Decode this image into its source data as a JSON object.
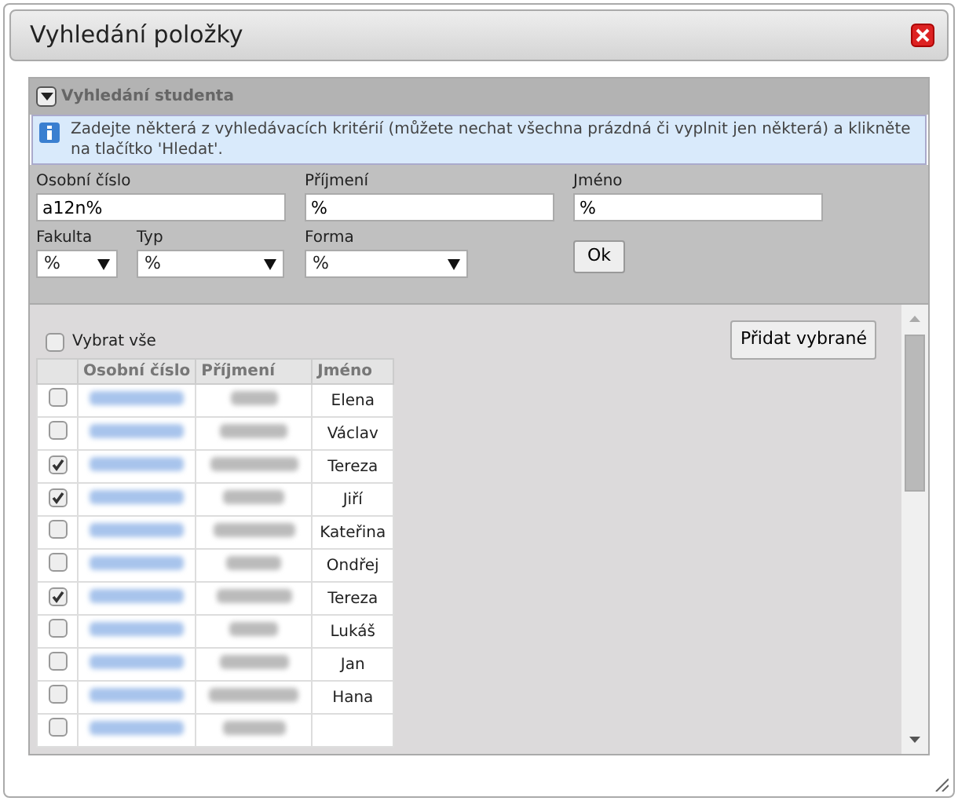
{
  "window": {
    "title": "Vyhledání položky"
  },
  "section": {
    "title": "Vyhledání studenta",
    "expanded": true
  },
  "info": "Zadejte některá z vyhledávacích kritérií (můžete nechat všechna prázdná či vyplnit jen některá) a klikněte na tlačítko 'Hledat'.",
  "fields": [
    {
      "label": "Osobní číslo",
      "value": "a12n%"
    },
    {
      "label": "Příjmení",
      "value": "%"
    },
    {
      "label": "Jméno",
      "value": "%"
    }
  ],
  "selects": [
    {
      "label": "Fakulta",
      "value": "%"
    },
    {
      "label": "Typ",
      "value": "%"
    },
    {
      "label": "Forma",
      "value": "%"
    }
  ],
  "ok_button": "Ok",
  "select_all": {
    "label": "Vybrat vše",
    "checked": false
  },
  "add_button": "Přidat vybrané",
  "table": {
    "columns": [
      "Osobní číslo",
      "Příjmení",
      "Jméno"
    ],
    "rows": [
      {
        "checked": false,
        "name": "Elena"
      },
      {
        "checked": false,
        "name": "Václav"
      },
      {
        "checked": true,
        "name": "Tereza"
      },
      {
        "checked": true,
        "name": "Jiří"
      },
      {
        "checked": false,
        "name": "Kateřina"
      },
      {
        "checked": false,
        "name": "Ondřej"
      },
      {
        "checked": true,
        "name": "Tereza"
      },
      {
        "checked": false,
        "name": "Lukáš"
      },
      {
        "checked": false,
        "name": "Jan"
      },
      {
        "checked": false,
        "name": "Hana"
      },
      {
        "checked": false
      }
    ]
  }
}
